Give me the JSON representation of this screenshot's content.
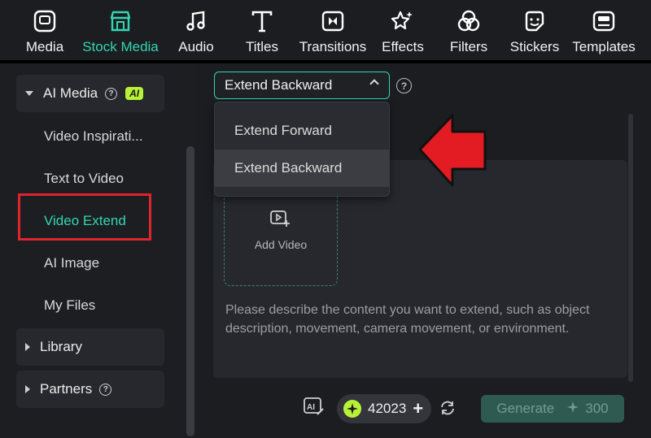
{
  "toolbar": {
    "tabs": [
      {
        "label": "Media",
        "icon": "media-icon"
      },
      {
        "label": "Stock Media",
        "icon": "stock-media-icon",
        "active": true
      },
      {
        "label": "Audio",
        "icon": "audio-icon"
      },
      {
        "label": "Titles",
        "icon": "titles-icon"
      },
      {
        "label": "Transitions",
        "icon": "transitions-icon"
      },
      {
        "label": "Effects",
        "icon": "effects-icon"
      },
      {
        "label": "Filters",
        "icon": "filters-icon"
      },
      {
        "label": "Stickers",
        "icon": "stickers-icon"
      },
      {
        "label": "Templates",
        "icon": "templates-icon"
      }
    ]
  },
  "sidebar": {
    "ai_media": {
      "label": "AI Media",
      "badge": "AI"
    },
    "items": [
      {
        "label": "Video Inspirati..."
      },
      {
        "label": "Text to Video"
      },
      {
        "label": "Video Extend",
        "active": true
      },
      {
        "label": "AI Image"
      },
      {
        "label": "My Files"
      }
    ],
    "library": {
      "label": "Library"
    },
    "partners": {
      "label": "Partners"
    }
  },
  "main": {
    "mode_select": {
      "value": "Extend Backward",
      "options": [
        "Extend Forward",
        "Extend Backward"
      ]
    },
    "add_video_label": "Add Video",
    "prompt_placeholder": "Please describe the content you want to extend, such as object description, movement, camera movement, or environment.",
    "credits": "42023",
    "generate": {
      "label": "Generate",
      "cost": "300"
    }
  },
  "colors": {
    "accent": "#34d5b2",
    "highlight_box": "#e0242c",
    "pointer_arrow": "#e31b23",
    "ai_badge": "#b8f236"
  }
}
